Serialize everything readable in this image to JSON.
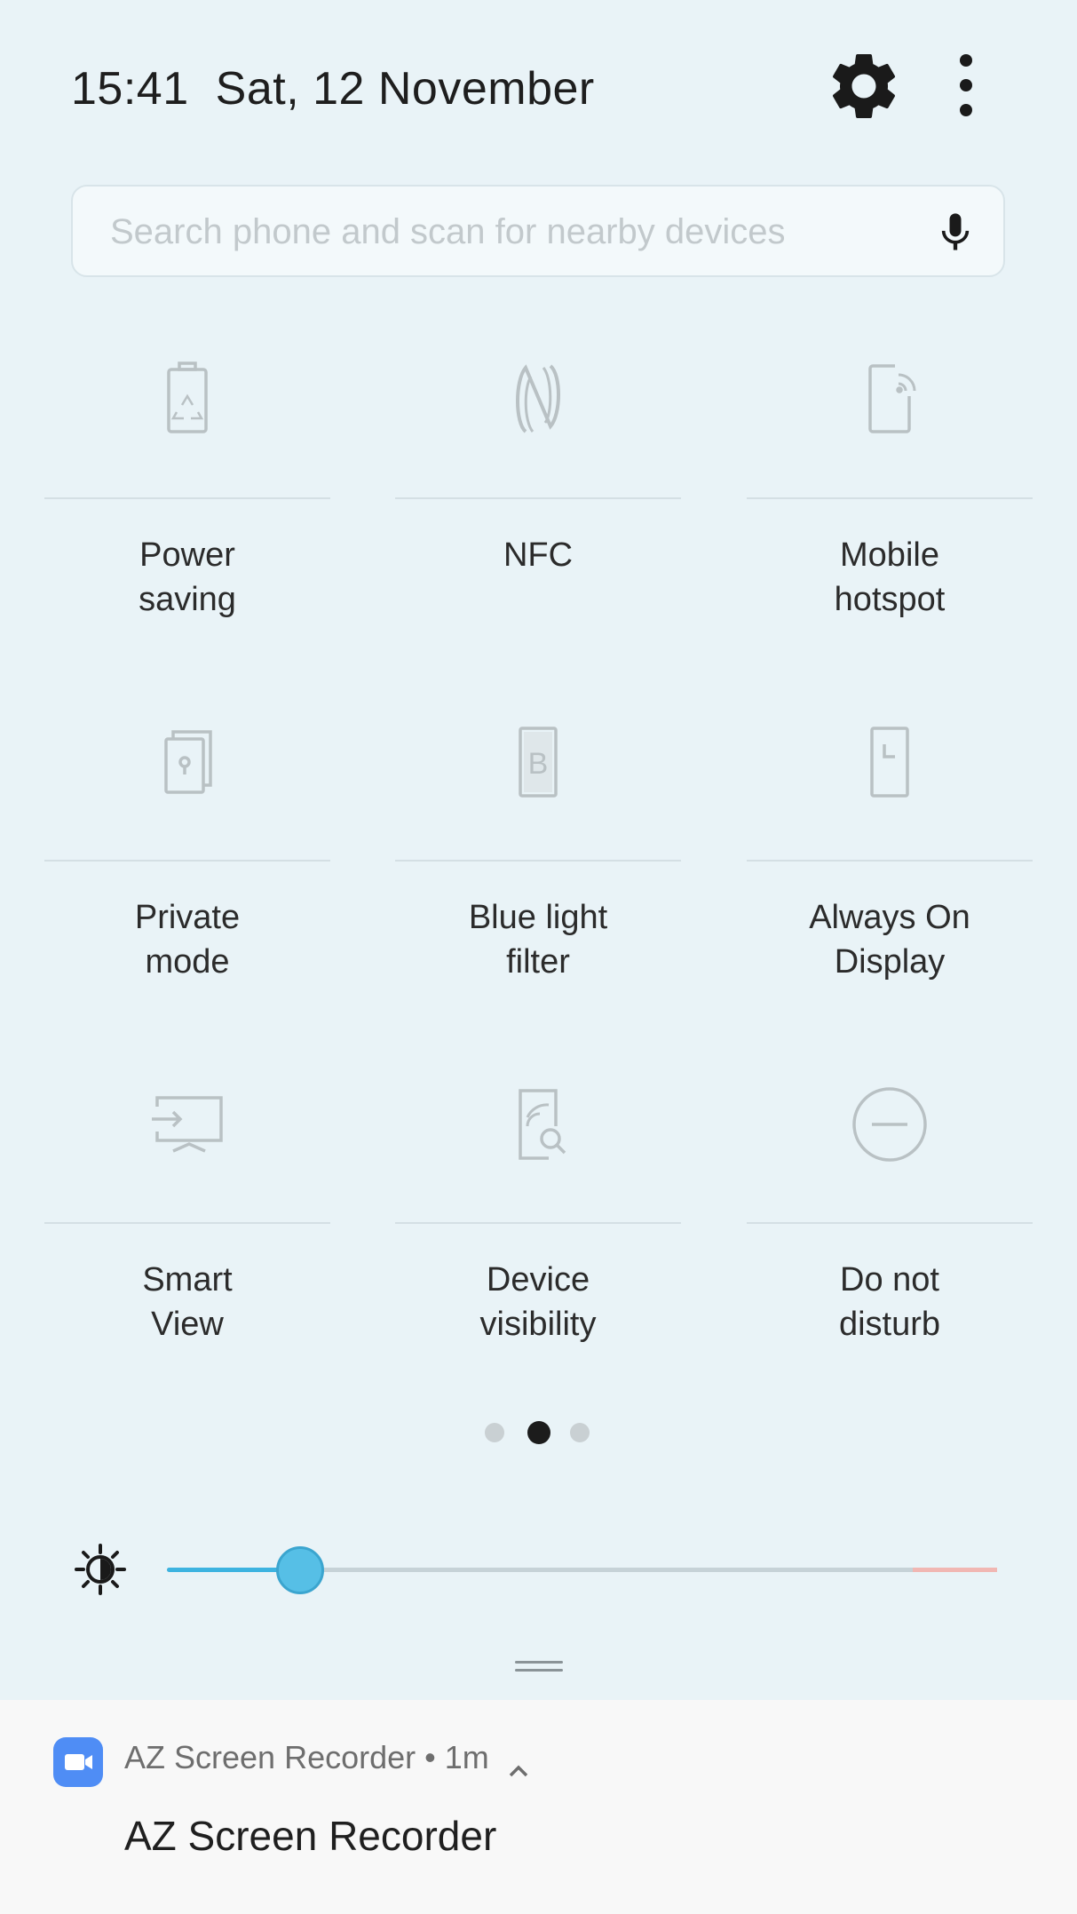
{
  "status": {
    "time": "15:41",
    "date": "Sat, 12 November"
  },
  "header": {
    "settings_icon": "gear-icon",
    "more_icon": "more-vertical-icon"
  },
  "search": {
    "placeholder": "Search phone and scan for nearby devices",
    "mic_icon": "microphone-icon"
  },
  "tiles": [
    {
      "label": "Power\nsaving",
      "icon": "power-saving-icon"
    },
    {
      "label": "NFC",
      "icon": "nfc-icon"
    },
    {
      "label": "Mobile\nhotspot",
      "icon": "mobile-hotspot-icon"
    },
    {
      "label": "Private\nmode",
      "icon": "private-mode-icon"
    },
    {
      "label": "Blue light\nfilter",
      "icon": "blue-light-filter-icon"
    },
    {
      "label": "Always On\nDisplay",
      "icon": "always-on-display-icon"
    },
    {
      "label": "Smart\nView",
      "icon": "smart-view-icon"
    },
    {
      "label": "Device\nvisibility",
      "icon": "device-visibility-icon"
    },
    {
      "label": "Do not\ndisturb",
      "icon": "do-not-disturb-icon"
    }
  ],
  "pager": {
    "pages": 3,
    "current": 2
  },
  "brightness": {
    "level": 0.16,
    "icon": "brightness-icon"
  },
  "notification": {
    "app": "AZ Screen Recorder",
    "separator": "•",
    "time": "1m",
    "title": "AZ Screen Recorder",
    "icon": "video-camera-icon"
  },
  "colors": {
    "accent": "#3db3e0",
    "background": "#e9f3f7",
    "tile_icon": "#b9c1c4",
    "app_icon": "#4f8df5"
  }
}
